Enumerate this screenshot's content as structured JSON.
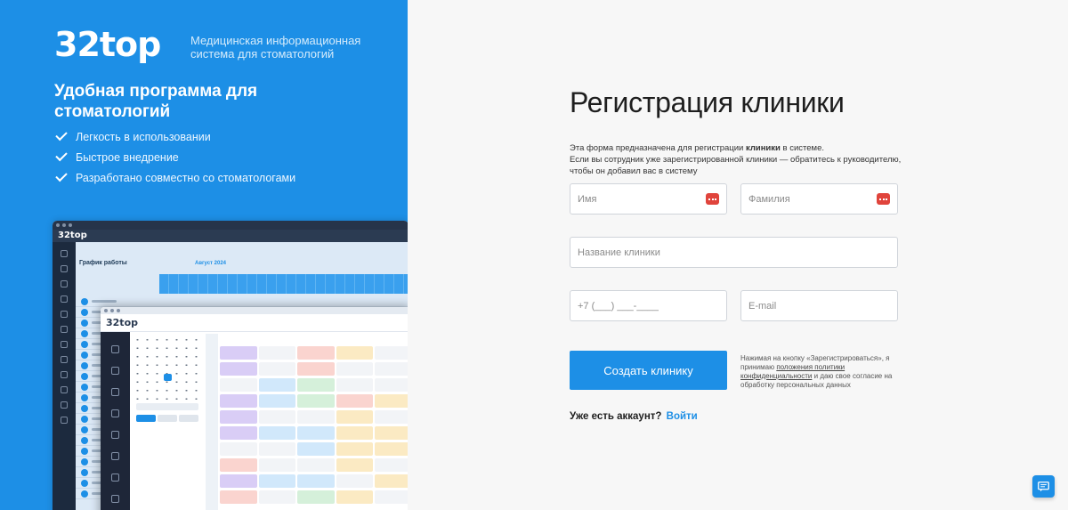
{
  "promo": {
    "logo": "32top",
    "tagline": "Медицинская информационная система для стоматологий",
    "title": "Удобная программа для стоматологий",
    "features": [
      "Легкость в использовании",
      "Быстрое внедрение",
      "Разработано совместно со стоматологами"
    ],
    "mockup": {
      "app_name": "32top",
      "schedule_title": "График работы",
      "month": "Август 2024",
      "front_app_name": "32top"
    }
  },
  "form": {
    "title": "Регистрация клиники",
    "info_prefix": "Эта форма предназначена для регистрации",
    "info_bold": "клиники",
    "info_suffix": "в системе.",
    "info_line2": "Если вы сотрудник уже зарегистрированной клиники — обратитесь к руководителю, чтобы он добавил вас в систему",
    "first_name_placeholder": "Имя",
    "last_name_placeholder": "Фамилия",
    "clinic_name_placeholder": "Название клиники",
    "phone_mask": "+7 (___) ___-____",
    "email_placeholder": "E-mail",
    "submit_label": "Создать клинику",
    "consent_prefix": "Нажимая на кнопку «Зарегистрироваться», я принимаю",
    "consent_link": "положения политики конфиденциальности",
    "consent_suffix": "и даю свое согласие на обработку персональных данных",
    "have_account": "Уже есть аккаунт?",
    "login_link": "Войти"
  },
  "colors": {
    "accent": "#1d8fe6",
    "field_icon": "#e0443c"
  },
  "icons": {
    "feature_bullet": "check-icon",
    "field_autofill": "keyboard-icon",
    "chat": "chat-icon"
  }
}
